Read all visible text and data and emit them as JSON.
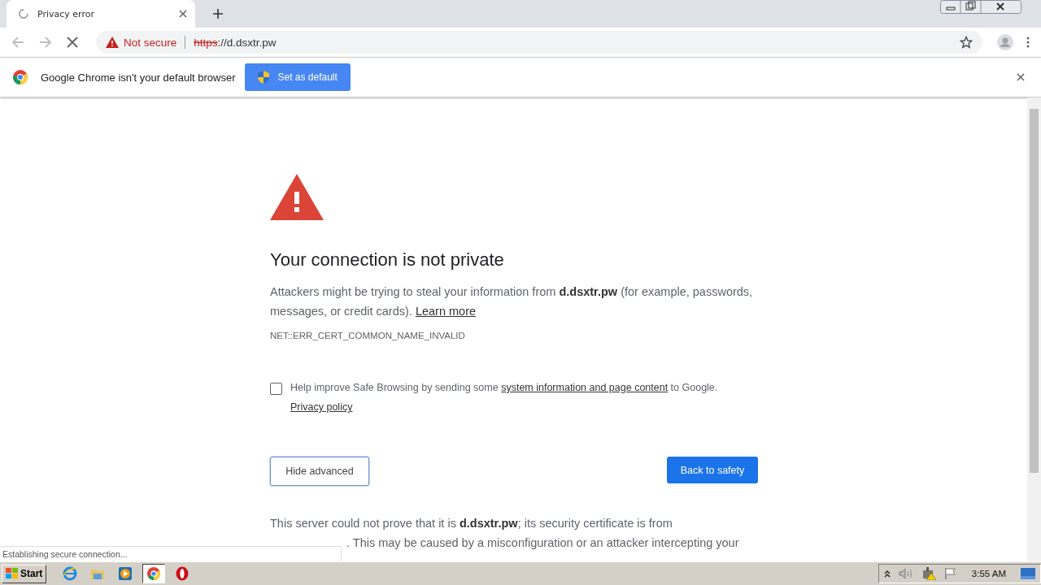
{
  "tabs": [
    {
      "title": "Privacy error",
      "selected": true,
      "loading": true
    }
  ],
  "toolbar": {
    "security_label": "Not secure",
    "url_scheme": "https",
    "url_rest": "://d.dsxtr.pw",
    "loading": true
  },
  "infobar": {
    "message": "Google Chrome isn't your default browser",
    "button": "Set as default"
  },
  "page": {
    "title": "Your connection is not private",
    "warning": "Attackers might be trying to steal your information from **d.dsxtr.pw** (for example, passwords, messages, or credit cards).",
    "learn_more": "Learn more",
    "error_code": "NET::ERR_CERT_COMMON_NAME_INVALID",
    "opt_in": {
      "checked": false,
      "before": "Help improve Safe Browsing by sending some",
      "link": "system information and page content",
      "after": "to Google.",
      "policy": "Privacy policy"
    },
    "advanced_button": "Hide advanced",
    "safety_button": "Back to safety",
    "details_line_1": "This server could not prove that it is **d.dsxtr.pw**; its security certificate is from",
    "details_line_2": ". This may be caused by a misconfiguration or an attacker intercepting your"
  },
  "status_bubble": "Establishing secure connection...",
  "taskbar": {
    "start": "Start",
    "apps": [
      {
        "kind": "ie",
        "selected": false
      },
      {
        "kind": "folder",
        "selected": false
      },
      {
        "kind": "media",
        "selected": false
      },
      {
        "kind": "chrome",
        "selected": true
      },
      {
        "kind": "opera",
        "selected": false
      }
    ],
    "clock": "3:55 AM"
  }
}
